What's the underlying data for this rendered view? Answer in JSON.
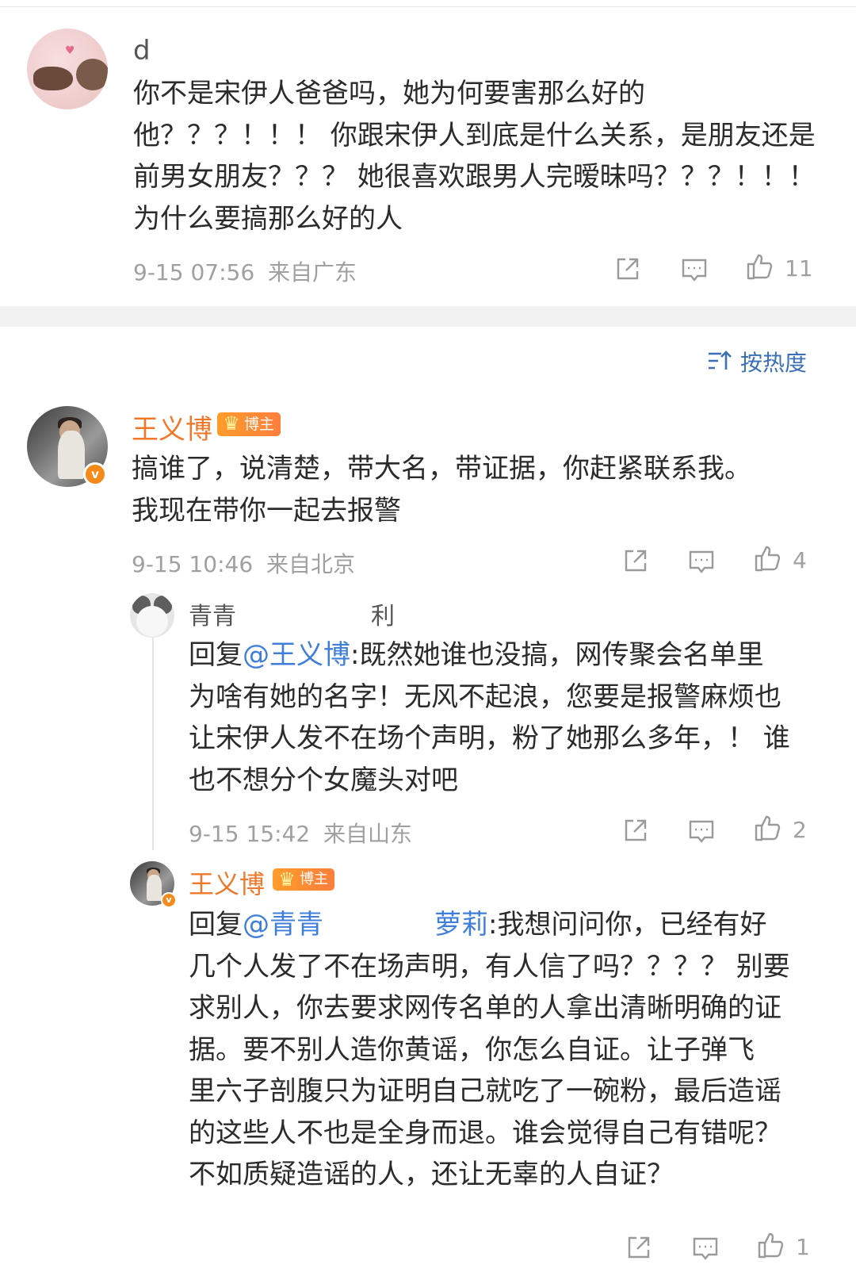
{
  "comments": [
    {
      "username": "d",
      "text": [
        "你不是宋伊人爸爸吗，她为何要害那么好的",
        "他？？？！！！ 你跟宋伊人到底是什么关系，是朋友还是",
        "前男女朋友？？？ 她很喜欢跟男人完暧昧吗？？？！！！",
        "为什么要搞那么好的人"
      ],
      "date": "9-15 07:56",
      "location": "来自广东",
      "like_count": "11"
    },
    {
      "username": "王义博",
      "badge": "博主",
      "text": [
        "搞谁了，说清楚，带大名，带证据，你赶紧联系我。",
        "我现在带你一起去报警"
      ],
      "date": "9-15 10:46",
      "location": "来自北京",
      "like_count": "4"
    }
  ],
  "sort": {
    "label": "按热度"
  },
  "replies": [
    {
      "username": "青青",
      "username_tail": "利",
      "reply_prefix": "回复",
      "reply_to": "@王义博",
      "text_first": ":既然她谁也没搞，网传聚会名单里",
      "text": [
        "为啥有她的名字！无风不起浪，您要是报警麻烦也",
        "让宋伊人发不在场个声明，粉了她那么多年，！ 谁",
        "也不想分个女魔头对吧"
      ],
      "date": "9-15 15:42",
      "location": "来自山东",
      "like_count": "2"
    },
    {
      "username": "王义博",
      "badge": "博主",
      "reply_prefix": "回复",
      "reply_to": "@青青",
      "reply_to_tail": "萝莉",
      "text_first": ":我想问问你，已经有好",
      "text": [
        "几个人发了不在场声明，有人信了吗？？？？ 别要",
        "求别人，你去要求网传名单的人拿出清晰明确的证",
        "据。要不别人造你黄谣，你怎么自证。让子弹飞",
        "里六子剖腹只为证明自己就吃了一碗粉，最后造谣",
        "的这些人不也是全身而退。谁会觉得自己有错呢？",
        "不如质疑造谣的人，还让无辜的人自证？"
      ],
      "like_count": "1"
    }
  ],
  "icons": {
    "share": "share-icon",
    "comment": "comment-icon",
    "like": "thumbs-up-icon",
    "verified": "verified-v-icon",
    "crown": "crown-icon",
    "sort": "sort-icon"
  },
  "badge_glyphs": {
    "verified": "v",
    "crown": "♛",
    "heart": "♥"
  },
  "colors": {
    "username_host": "#f0782a",
    "mention": "#3f7fd9",
    "meta": "#a0a0a0",
    "sort": "#3b6fb6",
    "badge": "#ff8a30"
  }
}
